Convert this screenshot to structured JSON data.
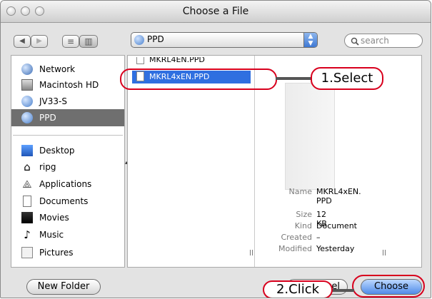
{
  "window": {
    "title": "Choose a File"
  },
  "toolbar": {
    "back": "◀",
    "forward": "▶",
    "view_list": "≡",
    "view_columns": "▥",
    "location": "PPD",
    "search_placeholder": "search"
  },
  "sidebar": {
    "items": [
      {
        "label": "Network",
        "icon": "network-icon"
      },
      {
        "label": "Macintosh HD",
        "icon": "hard-drive-icon"
      },
      {
        "label": "JV33-S",
        "icon": "disk-icon"
      },
      {
        "label": "PPD",
        "icon": "disk-icon",
        "selected": true
      },
      {
        "label": "Desktop",
        "icon": "desktop-icon"
      },
      {
        "label": "ripg",
        "icon": "home-icon"
      },
      {
        "label": "Applications",
        "icon": "applications-icon"
      },
      {
        "label": "Documents",
        "icon": "documents-icon"
      },
      {
        "label": "Movies",
        "icon": "movies-icon"
      },
      {
        "label": "Music",
        "icon": "music-icon"
      },
      {
        "label": "Pictures",
        "icon": "pictures-icon"
      }
    ]
  },
  "files": [
    {
      "name": "MKRL4EN.PPD",
      "selected": false
    },
    {
      "name": "MKRL4xEN.PPD",
      "selected": true
    }
  ],
  "preview": {
    "name_label": "Name",
    "name_value_line1": "MKRL4xEN.",
    "name_value_line2": "PPD",
    "size_label": "Size",
    "size_value": "12 KB",
    "kind_label": "Kind",
    "kind_value": "Document",
    "created_label": "Created",
    "created_value": "–",
    "modified_label": "Modified",
    "modified_value": "Yesterday"
  },
  "buttons": {
    "new_folder": "New Folder",
    "cancel": "Cancel",
    "cancel_visible": "ancel",
    "choose": "Choose"
  },
  "annotations": {
    "select_label": "1.Select",
    "click_label": "2.Click",
    "callout_color": "#d8001d"
  }
}
